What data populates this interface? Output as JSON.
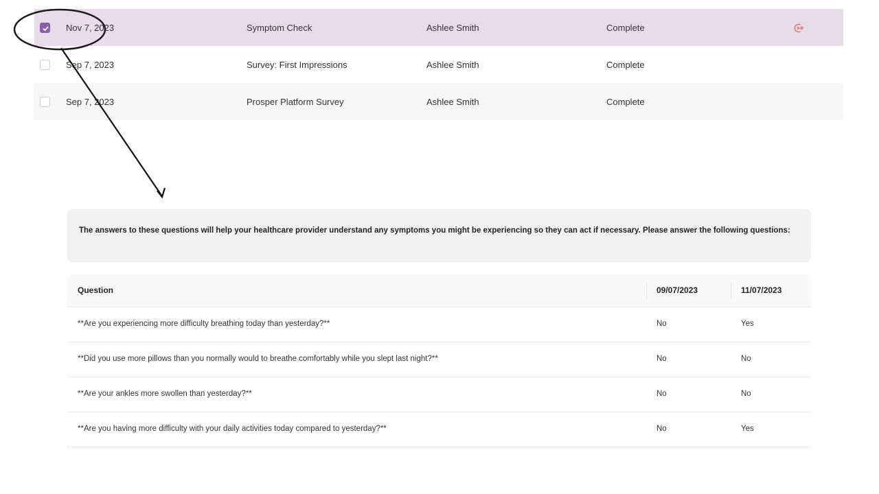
{
  "records": [
    {
      "date": "Nov 7, 2023",
      "name": "Symptom Check",
      "patient": "Ashlee Smith",
      "status": "Complete",
      "checked": true
    },
    {
      "date": "Sep 7, 2023",
      "name": "Survey: First Impressions",
      "patient": "Ashlee Smith",
      "status": "Complete",
      "checked": false
    },
    {
      "date": "Sep 7, 2023",
      "name": "Prosper Platform Survey",
      "patient": "Ashlee Smith",
      "status": "Complete",
      "checked": false
    }
  ],
  "colors": {
    "accent": "#8a5fb0",
    "selected_row": "#e6dde9",
    "action_icon": "#e06a5a"
  },
  "icons": {
    "row_action": "export-arrow-icon",
    "checkbox_check": "checkmark-icon"
  },
  "intro_text": "The answers to these questions will help your healthcare provider understand any symptoms you might be experiencing so they can act if necessary. Please answer the following questions:",
  "question_table": {
    "headers": {
      "question": "Question",
      "date1": "09/07/2023",
      "date2": "11/07/2023"
    },
    "rows": [
      {
        "question": "**Are you experiencing more difficulty breathing today than yesterday?**",
        "a1": "No",
        "a2": "Yes"
      },
      {
        "question": "**Did you use more pillows than you normally would to breathe comfortably while you slept last night?**",
        "a1": "No",
        "a2": "No"
      },
      {
        "question": "**Are your ankles more swollen than yesterday?**",
        "a1": "No",
        "a2": "No"
      },
      {
        "question": "**Are you having more difficulty with your daily activities today compared to yesterday?**",
        "a1": "No",
        "a2": "Yes"
      }
    ]
  }
}
